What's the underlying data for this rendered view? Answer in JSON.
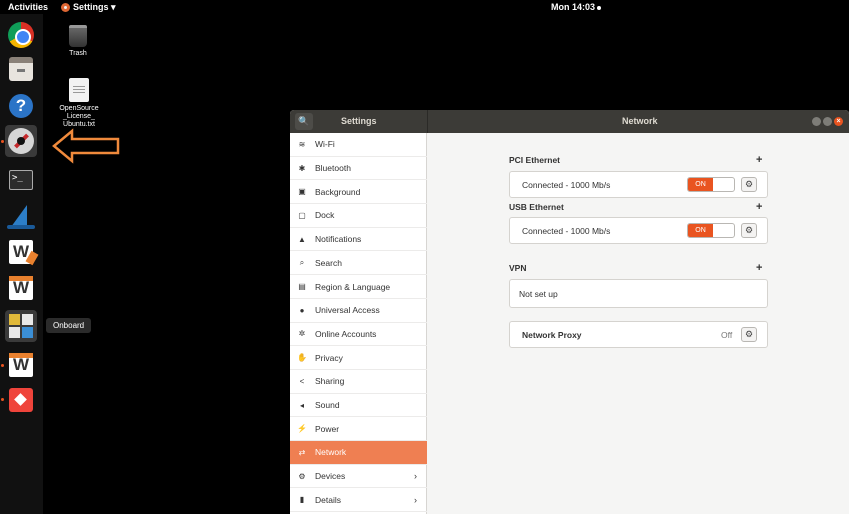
{
  "topbar": {
    "activities": "Activities",
    "app_menu": "Settings ▾",
    "clock": "Mon 14:03"
  },
  "dock": {
    "tooltip": "Onboard",
    "icons": [
      "chrome-icon",
      "files-icon",
      "help-icon",
      "settings-icon",
      "terminal-icon",
      "wireshark-icon",
      "wps-writer-icon",
      "wps-office-icon",
      "onboard-icon",
      "wps-icon",
      "anydesk-icon"
    ]
  },
  "desktop": {
    "trash_label": "Trash",
    "license_label": "OpenSource _License_ Ubuntu.txt"
  },
  "window": {
    "left_title": "Settings",
    "center_title": "Network",
    "search_glyph": "🔍",
    "close_glyph": "×"
  },
  "sidebar": {
    "items": [
      {
        "label": "Wi-Fi",
        "icon": "≋"
      },
      {
        "label": "Bluetooth",
        "icon": "✱"
      },
      {
        "label": "Background",
        "icon": "▣"
      },
      {
        "label": "Dock",
        "icon": "▢"
      },
      {
        "label": "Notifications",
        "icon": "▲"
      },
      {
        "label": "Search",
        "icon": "⌕"
      },
      {
        "label": "Region & Language",
        "icon": "▤"
      },
      {
        "label": "Universal Access",
        "icon": "●"
      },
      {
        "label": "Online Accounts",
        "icon": "✲"
      },
      {
        "label": "Privacy",
        "icon": "✋"
      },
      {
        "label": "Sharing",
        "icon": "<"
      },
      {
        "label": "Sound",
        "icon": "◂"
      },
      {
        "label": "Power",
        "icon": "⚡"
      },
      {
        "label": "Network",
        "icon": "⇄"
      },
      {
        "label": "Devices",
        "icon": "⚙",
        "chevron": "›"
      },
      {
        "label": "Details",
        "icon": "▮",
        "chevron": "›"
      }
    ]
  },
  "network": {
    "pci": {
      "title": "PCI Ethernet",
      "status": "Connected - 1000 Mb/s",
      "toggle": "ON"
    },
    "usb": {
      "title": "USB Ethernet",
      "status": "Connected - 1000 Mb/s",
      "toggle": "ON"
    },
    "vpn": {
      "title": "VPN",
      "status": "Not set up"
    },
    "proxy": {
      "title": "Network Proxy",
      "value": "Off"
    },
    "plus": "+",
    "gear_glyph": "⚙"
  },
  "colors": {
    "accent": "#e95420",
    "selection": "#ef7f52",
    "annotation_arrow": "#f08a3c"
  }
}
